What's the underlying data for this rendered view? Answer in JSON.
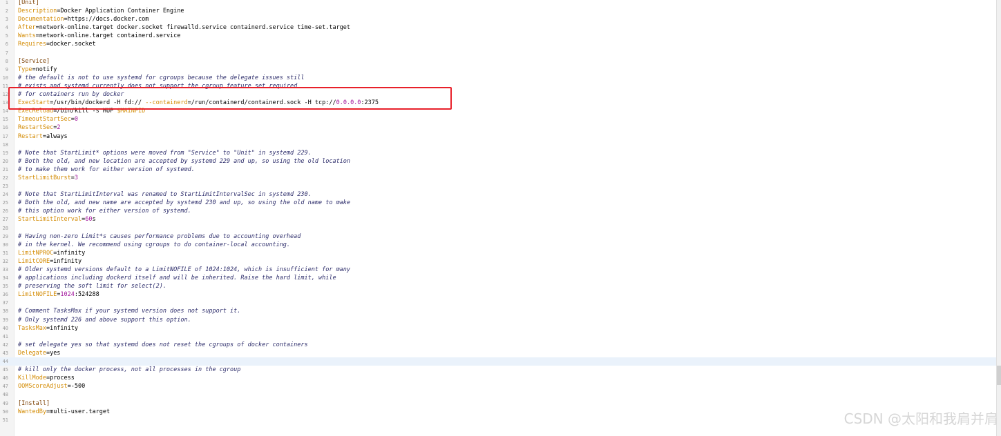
{
  "lines": [
    {
      "n": "1",
      "parts": [
        [
          "section",
          "[Unit]"
        ]
      ]
    },
    {
      "n": "2",
      "parts": [
        [
          "key",
          "Description"
        ],
        [
          "plain",
          "=Docker Application Container Engine"
        ]
      ]
    },
    {
      "n": "3",
      "parts": [
        [
          "key",
          "Documentation"
        ],
        [
          "plain",
          "=https://docs.docker.com"
        ]
      ]
    },
    {
      "n": "4",
      "parts": [
        [
          "key",
          "After"
        ],
        [
          "plain",
          "=network-online.target docker.socket firewalld.service containerd.service time-set.target"
        ]
      ]
    },
    {
      "n": "5",
      "parts": [
        [
          "key",
          "Wants"
        ],
        [
          "plain",
          "=network-online.target containerd.service"
        ]
      ]
    },
    {
      "n": "6",
      "parts": [
        [
          "key",
          "Requires"
        ],
        [
          "plain",
          "=docker.socket"
        ]
      ]
    },
    {
      "n": "7",
      "parts": []
    },
    {
      "n": "8",
      "parts": [
        [
          "section",
          "[Service]"
        ]
      ]
    },
    {
      "n": "9",
      "parts": [
        [
          "key",
          "Type"
        ],
        [
          "plain",
          "=notify"
        ]
      ]
    },
    {
      "n": "10",
      "parts": [
        [
          "cmt",
          "# the default is not to use systemd for cgroups because the delegate issues still"
        ]
      ]
    },
    {
      "n": "11",
      "parts": [
        [
          "cmt",
          "# exists and systemd currently does not support the cgroup feature set required"
        ]
      ]
    },
    {
      "n": "12",
      "parts": [
        [
          "cmt",
          "# for containers run by docker"
        ]
      ]
    },
    {
      "n": "13",
      "parts": [
        [
          "key",
          "ExecStart"
        ],
        [
          "plain",
          "=/usr/bin/dockerd -H fd:// "
        ],
        [
          "key",
          "--containerd"
        ],
        [
          "plain",
          "=/run/containerd/containerd.sock -H tcp://"
        ],
        [
          "num",
          "0.0.0.0"
        ],
        [
          "plain",
          ":2375"
        ]
      ]
    },
    {
      "n": "14",
      "parts": [
        [
          "key",
          "ExecReload"
        ],
        [
          "plain",
          "=/bin/kill -s HUP "
        ],
        [
          "var",
          "$MAINPID"
        ]
      ]
    },
    {
      "n": "15",
      "parts": [
        [
          "key",
          "TimeoutStartSec"
        ],
        [
          "plain",
          "="
        ],
        [
          "num",
          "0"
        ]
      ]
    },
    {
      "n": "16",
      "parts": [
        [
          "key",
          "RestartSec"
        ],
        [
          "plain",
          "="
        ],
        [
          "num",
          "2"
        ]
      ]
    },
    {
      "n": "17",
      "parts": [
        [
          "key",
          "Restart"
        ],
        [
          "plain",
          "=always"
        ]
      ]
    },
    {
      "n": "18",
      "parts": []
    },
    {
      "n": "19",
      "parts": [
        [
          "cmt",
          "# Note that StartLimit* options were moved from \"Service\" to \"Unit\" in systemd 229."
        ]
      ]
    },
    {
      "n": "20",
      "parts": [
        [
          "cmt",
          "# Both the old, and new location are accepted by systemd 229 and up, so using the old location"
        ]
      ]
    },
    {
      "n": "21",
      "parts": [
        [
          "cmt",
          "# to make them work for either version of systemd."
        ]
      ]
    },
    {
      "n": "22",
      "parts": [
        [
          "key",
          "StartLimitBurst"
        ],
        [
          "plain",
          "="
        ],
        [
          "num",
          "3"
        ]
      ]
    },
    {
      "n": "23",
      "parts": []
    },
    {
      "n": "24",
      "parts": [
        [
          "cmt",
          "# Note that StartLimitInterval was renamed to StartLimitIntervalSec in systemd 230."
        ]
      ]
    },
    {
      "n": "25",
      "parts": [
        [
          "cmt",
          "# Both the old, and new name are accepted by systemd 230 and up, so using the old name to make"
        ]
      ]
    },
    {
      "n": "26",
      "parts": [
        [
          "cmt",
          "# this option work for either version of systemd."
        ]
      ]
    },
    {
      "n": "27",
      "parts": [
        [
          "key",
          "StartLimitInterval"
        ],
        [
          "plain",
          "="
        ],
        [
          "num",
          "60"
        ],
        [
          "plain",
          "s"
        ]
      ]
    },
    {
      "n": "28",
      "parts": []
    },
    {
      "n": "29",
      "parts": [
        [
          "cmt",
          "# Having non-zero Limit*s causes performance problems due to accounting overhead"
        ]
      ]
    },
    {
      "n": "30",
      "parts": [
        [
          "cmt",
          "# in the kernel. We recommend using cgroups to do container-local accounting."
        ]
      ]
    },
    {
      "n": "31",
      "parts": [
        [
          "key",
          "LimitNPROC"
        ],
        [
          "plain",
          "=infinity"
        ]
      ]
    },
    {
      "n": "32",
      "parts": [
        [
          "key",
          "LimitCORE"
        ],
        [
          "plain",
          "=infinity"
        ]
      ]
    },
    {
      "n": "33",
      "parts": [
        [
          "cmt",
          "# Older systemd versions default to a LimitNOFILE of 1024:1024, which is insufficient for many"
        ]
      ]
    },
    {
      "n": "34",
      "parts": [
        [
          "cmt",
          "# applications including dockerd itself and will be inherited. Raise the hard limit, while"
        ]
      ]
    },
    {
      "n": "35",
      "parts": [
        [
          "cmt",
          "# preserving the soft limit for select(2)."
        ]
      ]
    },
    {
      "n": "36",
      "parts": [
        [
          "key",
          "LimitNOFILE"
        ],
        [
          "plain",
          "="
        ],
        [
          "num",
          "1024"
        ],
        [
          "plain",
          ":524288"
        ]
      ]
    },
    {
      "n": "37",
      "parts": []
    },
    {
      "n": "38",
      "parts": [
        [
          "cmt",
          "# Comment TasksMax if your systemd version does not support it."
        ]
      ]
    },
    {
      "n": "39",
      "parts": [
        [
          "cmt",
          "# Only systemd 226 and above support this option."
        ]
      ]
    },
    {
      "n": "40",
      "parts": [
        [
          "key",
          "TasksMax"
        ],
        [
          "plain",
          "=infinity"
        ]
      ]
    },
    {
      "n": "41",
      "parts": []
    },
    {
      "n": "42",
      "parts": [
        [
          "cmt",
          "# set delegate yes so that systemd does not reset the cgroups of docker containers"
        ]
      ]
    },
    {
      "n": "43",
      "parts": [
        [
          "key",
          "Delegate"
        ],
        [
          "plain",
          "=yes"
        ]
      ]
    },
    {
      "n": "44",
      "parts": [],
      "current": true
    },
    {
      "n": "45",
      "parts": [
        [
          "cmt",
          "# kill only the docker process, not all processes in the cgroup"
        ]
      ]
    },
    {
      "n": "46",
      "parts": [
        [
          "key",
          "KillMode"
        ],
        [
          "plain",
          "=process"
        ]
      ]
    },
    {
      "n": "47",
      "parts": [
        [
          "key",
          "OOMScoreAdjust"
        ],
        [
          "plain",
          "=-500"
        ]
      ]
    },
    {
      "n": "48",
      "parts": []
    },
    {
      "n": "49",
      "parts": [
        [
          "section",
          "[Install]"
        ]
      ]
    },
    {
      "n": "50",
      "parts": [
        [
          "key",
          "WantedBy"
        ],
        [
          "plain",
          "=multi-user.target"
        ]
      ]
    },
    {
      "n": "51",
      "parts": []
    }
  ],
  "watermark": "CSDN @太阳和我肩并肩",
  "colors": {
    "section": "#7a3e00",
    "key": "#d38a00",
    "comment": "#2d2d6b",
    "number": "#a0109a",
    "highlight_box": "#e8202a"
  }
}
